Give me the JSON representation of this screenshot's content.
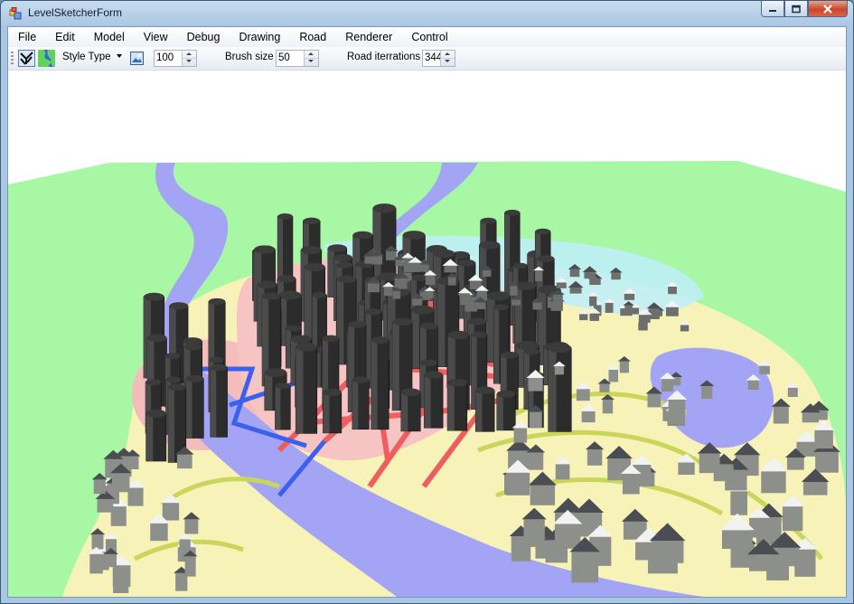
{
  "window": {
    "title": "LevelSketcherForm"
  },
  "menu": {
    "items": [
      "File",
      "Edit",
      "Model",
      "View",
      "Debug",
      "Drawing",
      "Road",
      "Renderer",
      "Control"
    ]
  },
  "toolbar": {
    "style_type_label": "Style Type",
    "zoom_value": "100",
    "brush_size_label": "Brush size",
    "brush_size_value": "50",
    "road_iterations_label": "Road iterrations",
    "road_iterations_value": "344"
  },
  "icons": {
    "app": "app-icon",
    "road-tool": "road-tool-icon",
    "river-tool": "river-tool-icon",
    "image-tool": "image-icon"
  },
  "colors": {
    "grass": "#a7f7a5",
    "water": "#a4a4f4",
    "sand": "#f7f2b8",
    "road": "#ef5e5e",
    "building": "#2a2b2a"
  }
}
